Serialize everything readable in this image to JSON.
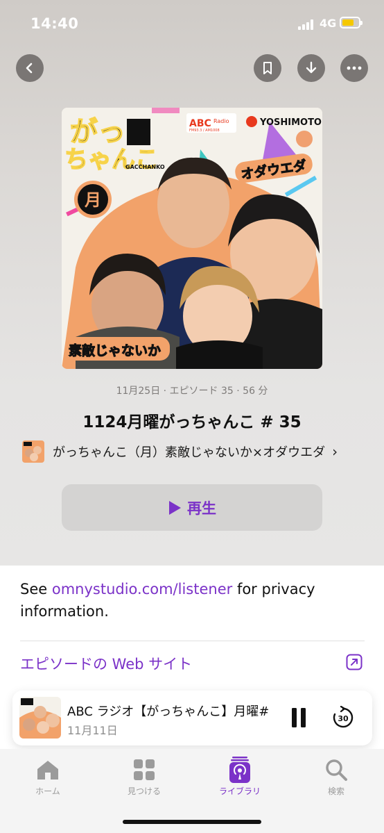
{
  "status": {
    "time": "14:40",
    "network": "4G"
  },
  "nav": {
    "back_icon": "chevron-left-icon",
    "bookmark_icon": "bookmark-icon",
    "download_icon": "download-icon",
    "more_icon": "ellipsis-icon"
  },
  "artwork": {
    "title_top": "がっ",
    "title_bottom": "ちゃんこ",
    "romaji": "GACCHANKO",
    "day_mark": "月",
    "brand_abc": "ABC",
    "brand_radio": "Radio",
    "brand_freq": "FM93.3 / AM1008",
    "brand_yoshimoto": "YOSHIMOTO",
    "label_right": "オダウエダ",
    "label_left": "素敵じゃないか"
  },
  "episode": {
    "meta": "11月25日 · エピソード 35 · 56 分",
    "title": "1124月曜がっちゃんこ # 35",
    "show_name": "がっちゃんこ（月）素敵じゃないか×オダウエダ",
    "chevron": "›",
    "play_label": "再生"
  },
  "description": {
    "prefix": "See ",
    "link": "omnystudio.com/listener",
    "suffix": " for privacy information.",
    "web_link": "エピソードの Web サイト"
  },
  "mini_player": {
    "title": "ABC ラジオ【がっちゃんこ】月曜#",
    "date": "11月11日",
    "skip_label": "30"
  },
  "tabs": [
    {
      "label": "ホーム",
      "icon": "home-icon",
      "active": false
    },
    {
      "label": "見つける",
      "icon": "grid-icon",
      "active": false
    },
    {
      "label": "ライブラリ",
      "icon": "podcasts-icon",
      "active": true
    },
    {
      "label": "検索",
      "icon": "search-icon",
      "active": false
    }
  ],
  "colors": {
    "accent": "#7b32c8",
    "battery": "#f5c800"
  }
}
